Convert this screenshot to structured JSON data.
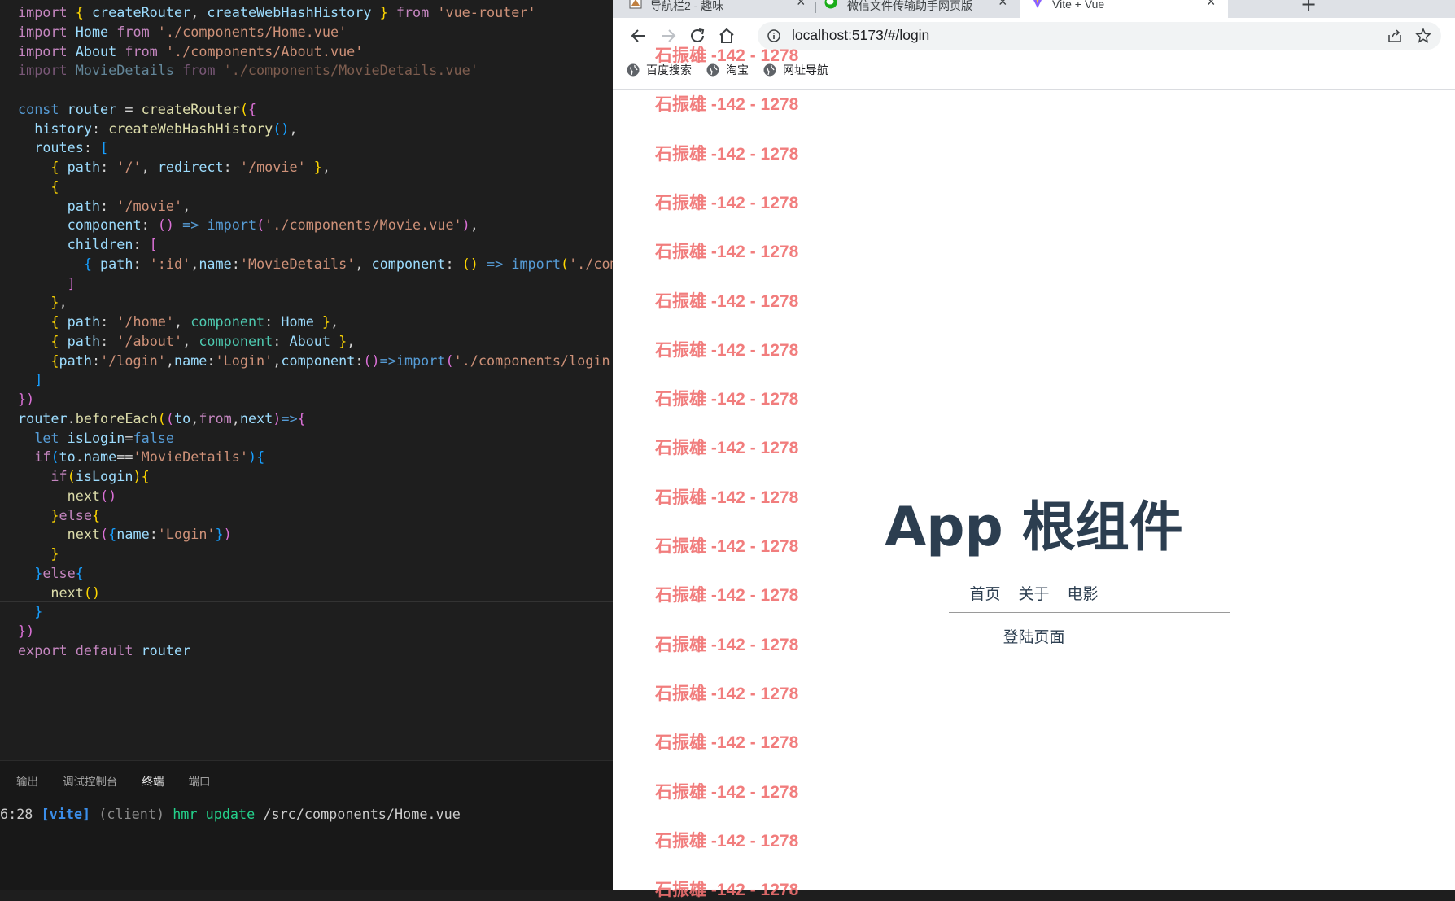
{
  "editor": {
    "lines": [
      [
        {
          "t": "import",
          "c": "kw"
        },
        {
          "t": " "
        },
        {
          "t": "{",
          "c": "b1"
        },
        {
          "t": " "
        },
        {
          "t": "createRouter",
          "c": "var"
        },
        {
          "t": ", "
        },
        {
          "t": "createWebHashHistory",
          "c": "var"
        },
        {
          "t": " "
        },
        {
          "t": "}",
          "c": "b1"
        },
        {
          "t": " "
        },
        {
          "t": "from",
          "c": "kw"
        },
        {
          "t": " "
        },
        {
          "t": "'vue-router'",
          "c": "str"
        }
      ],
      [
        {
          "t": "import",
          "c": "kw"
        },
        {
          "t": " "
        },
        {
          "t": "Home",
          "c": "var"
        },
        {
          "t": " "
        },
        {
          "t": "from",
          "c": "kw"
        },
        {
          "t": " "
        },
        {
          "t": "'./components/Home.vue'",
          "c": "str"
        }
      ],
      [
        {
          "t": "import",
          "c": "kw"
        },
        {
          "t": " "
        },
        {
          "t": "About",
          "c": "var"
        },
        {
          "t": " "
        },
        {
          "t": "from",
          "c": "kw"
        },
        {
          "t": " "
        },
        {
          "t": "'./components/About.vue'",
          "c": "str"
        }
      ],
      [
        {
          "t": "import",
          "c": "kw dim"
        },
        {
          "t": " "
        },
        {
          "t": "MovieDetails",
          "c": "var dim"
        },
        {
          "t": " "
        },
        {
          "t": "from",
          "c": "kw dim"
        },
        {
          "t": " "
        },
        {
          "t": "'./components/MovieDetails.vue'",
          "c": "str dim"
        }
      ],
      [],
      [
        {
          "t": "const",
          "c": "kb"
        },
        {
          "t": " "
        },
        {
          "t": "router",
          "c": "var"
        },
        {
          "t": " = "
        },
        {
          "t": "createRouter",
          "c": "fn"
        },
        {
          "t": "(",
          "c": "b1"
        },
        {
          "t": "{",
          "c": "b2"
        }
      ],
      [
        {
          "t": "  "
        },
        {
          "t": "history",
          "c": "var"
        },
        {
          "t": ": "
        },
        {
          "t": "createWebHashHistory",
          "c": "fn"
        },
        {
          "t": "()",
          "c": "b3"
        },
        {
          "t": ","
        }
      ],
      [
        {
          "t": "  "
        },
        {
          "t": "routes",
          "c": "var"
        },
        {
          "t": ": "
        },
        {
          "t": "[",
          "c": "b3"
        }
      ],
      [
        {
          "t": "    "
        },
        {
          "t": "{",
          "c": "b1"
        },
        {
          "t": " "
        },
        {
          "t": "path",
          "c": "var"
        },
        {
          "t": ": "
        },
        {
          "t": "'/'",
          "c": "str"
        },
        {
          "t": ", "
        },
        {
          "t": "redirect",
          "c": "var"
        },
        {
          "t": ": "
        },
        {
          "t": "'/movie'",
          "c": "str"
        },
        {
          "t": " "
        },
        {
          "t": "}",
          "c": "b1"
        },
        {
          "t": ","
        }
      ],
      [
        {
          "t": "    "
        },
        {
          "t": "{",
          "c": "b1"
        }
      ],
      [
        {
          "t": "      "
        },
        {
          "t": "path",
          "c": "var"
        },
        {
          "t": ": "
        },
        {
          "t": "'/movie'",
          "c": "str"
        },
        {
          "t": ","
        }
      ],
      [
        {
          "t": "      "
        },
        {
          "t": "component",
          "c": "var"
        },
        {
          "t": ": "
        },
        {
          "t": "()",
          "c": "b2"
        },
        {
          "t": " "
        },
        {
          "t": "=>",
          "c": "kb"
        },
        {
          "t": " "
        },
        {
          "t": "import",
          "c": "kb"
        },
        {
          "t": "(",
          "c": "b2"
        },
        {
          "t": "'./components/Movie.vue'",
          "c": "str"
        },
        {
          "t": ")",
          "c": "b2"
        },
        {
          "t": ","
        }
      ],
      [
        {
          "t": "      "
        },
        {
          "t": "children",
          "c": "var"
        },
        {
          "t": ": "
        },
        {
          "t": "[",
          "c": "b2"
        }
      ],
      [
        {
          "t": "        "
        },
        {
          "t": "{",
          "c": "b3"
        },
        {
          "t": " "
        },
        {
          "t": "path",
          "c": "var"
        },
        {
          "t": ": "
        },
        {
          "t": "':id'",
          "c": "str"
        },
        {
          "t": ","
        },
        {
          "t": "name",
          "c": "var"
        },
        {
          "t": ":"
        },
        {
          "t": "'MovieDetails'",
          "c": "str"
        },
        {
          "t": ", "
        },
        {
          "t": "component",
          "c": "var"
        },
        {
          "t": ": "
        },
        {
          "t": "()",
          "c": "b1"
        },
        {
          "t": " "
        },
        {
          "t": "=>",
          "c": "kb"
        },
        {
          "t": " "
        },
        {
          "t": "import",
          "c": "kb"
        },
        {
          "t": "(",
          "c": "b1"
        },
        {
          "t": "'./compon",
          "c": "str"
        }
      ],
      [
        {
          "t": "      "
        },
        {
          "t": "]",
          "c": "b2"
        }
      ],
      [
        {
          "t": "    "
        },
        {
          "t": "}",
          "c": "b1"
        },
        {
          "t": ","
        }
      ],
      [
        {
          "t": "    "
        },
        {
          "t": "{",
          "c": "b1"
        },
        {
          "t": " "
        },
        {
          "t": "path",
          "c": "var"
        },
        {
          "t": ": "
        },
        {
          "t": "'/home'",
          "c": "str"
        },
        {
          "t": ", "
        },
        {
          "t": "component",
          "c": "cls"
        },
        {
          "t": ": "
        },
        {
          "t": "Home",
          "c": "var"
        },
        {
          "t": " "
        },
        {
          "t": "}",
          "c": "b1"
        },
        {
          "t": ","
        }
      ],
      [
        {
          "t": "    "
        },
        {
          "t": "{",
          "c": "b1"
        },
        {
          "t": " "
        },
        {
          "t": "path",
          "c": "var"
        },
        {
          "t": ": "
        },
        {
          "t": "'/about'",
          "c": "str"
        },
        {
          "t": ", "
        },
        {
          "t": "component",
          "c": "cls"
        },
        {
          "t": ": "
        },
        {
          "t": "About",
          "c": "var"
        },
        {
          "t": " "
        },
        {
          "t": "}",
          "c": "b1"
        },
        {
          "t": ","
        }
      ],
      [
        {
          "t": "    "
        },
        {
          "t": "{",
          "c": "b1"
        },
        {
          "t": "path",
          "c": "var"
        },
        {
          "t": ":"
        },
        {
          "t": "'/login'",
          "c": "str"
        },
        {
          "t": ","
        },
        {
          "t": "name",
          "c": "var"
        },
        {
          "t": ":"
        },
        {
          "t": "'Login'",
          "c": "str"
        },
        {
          "t": ","
        },
        {
          "t": "component",
          "c": "var"
        },
        {
          "t": ":"
        },
        {
          "t": "()",
          "c": "b2"
        },
        {
          "t": "=>",
          "c": "kb"
        },
        {
          "t": "import",
          "c": "kb"
        },
        {
          "t": "(",
          "c": "b2"
        },
        {
          "t": "'./components/login.vue",
          "c": "str"
        }
      ],
      [
        {
          "t": "  "
        },
        {
          "t": "]",
          "c": "b3"
        }
      ],
      [
        {
          "t": "})",
          "c": "b2"
        }
      ],
      [
        {
          "t": "router",
          "c": "var"
        },
        {
          "t": "."
        },
        {
          "t": "beforeEach",
          "c": "fn"
        },
        {
          "t": "(",
          "c": "b1"
        },
        {
          "t": "(",
          "c": "b2"
        },
        {
          "t": "to",
          "c": "var"
        },
        {
          "t": ","
        },
        {
          "t": "from",
          "c": "kw"
        },
        {
          "t": ","
        },
        {
          "t": "next",
          "c": "var"
        },
        {
          "t": ")",
          "c": "b2"
        },
        {
          "t": "=>",
          "c": "kb"
        },
        {
          "t": "{",
          "c": "b2"
        }
      ],
      [
        {
          "t": "  "
        },
        {
          "t": "let",
          "c": "kb"
        },
        {
          "t": " "
        },
        {
          "t": "isLogin",
          "c": "var"
        },
        {
          "t": "="
        },
        {
          "t": "false",
          "c": "kb"
        }
      ],
      [
        {
          "t": "  "
        },
        {
          "t": "if",
          "c": "kw"
        },
        {
          "t": "(",
          "c": "b3"
        },
        {
          "t": "to",
          "c": "var"
        },
        {
          "t": "."
        },
        {
          "t": "name",
          "c": "var"
        },
        {
          "t": "=="
        },
        {
          "t": "'MovieDetails'",
          "c": "str"
        },
        {
          "t": ")",
          "c": "b3"
        },
        {
          "t": "{",
          "c": "b3"
        }
      ],
      [
        {
          "t": "    "
        },
        {
          "t": "if",
          "c": "kw"
        },
        {
          "t": "(",
          "c": "b1"
        },
        {
          "t": "isLogin",
          "c": "var"
        },
        {
          "t": ")",
          "c": "b1"
        },
        {
          "t": "{",
          "c": "b1"
        }
      ],
      [
        {
          "t": "      "
        },
        {
          "t": "next",
          "c": "fn"
        },
        {
          "t": "()",
          "c": "b2"
        }
      ],
      [
        {
          "t": "    "
        },
        {
          "t": "}",
          "c": "b1"
        },
        {
          "t": "else",
          "c": "kw"
        },
        {
          "t": "{",
          "c": "b1"
        }
      ],
      [
        {
          "t": "      "
        },
        {
          "t": "next",
          "c": "fn"
        },
        {
          "t": "(",
          "c": "b2"
        },
        {
          "t": "{",
          "c": "b3"
        },
        {
          "t": "name",
          "c": "var"
        },
        {
          "t": ":"
        },
        {
          "t": "'Login'",
          "c": "str"
        },
        {
          "t": "}",
          "c": "b3"
        },
        {
          "t": ")",
          "c": "b2"
        }
      ],
      [
        {
          "t": "    "
        },
        {
          "t": "}",
          "c": "b1"
        }
      ],
      [
        {
          "t": "  "
        },
        {
          "t": "}",
          "c": "b3"
        },
        {
          "t": "else",
          "c": "kw"
        },
        {
          "t": "{",
          "c": "b3"
        }
      ],
      [
        {
          "t": "    "
        },
        {
          "t": "next",
          "c": "fn"
        },
        {
          "t": "()",
          "c": "b1"
        }
      ],
      [
        {
          "t": "  "
        },
        {
          "t": "}",
          "c": "b3"
        }
      ],
      [
        {
          "t": "})",
          "c": "b2"
        }
      ],
      [
        {
          "t": "export",
          "c": "kw"
        },
        {
          "t": " "
        },
        {
          "t": "default",
          "c": "kw"
        },
        {
          "t": " "
        },
        {
          "t": "router",
          "c": "var"
        }
      ]
    ],
    "cursor_line": 30
  },
  "panel": {
    "tabs": [
      "输出",
      "调试控制台",
      "终端",
      "端口"
    ],
    "active_tab": "终端",
    "terminal": {
      "time": "6:28",
      "tag": "[vite]",
      "client": "(client)",
      "hmr": "hmr update",
      "path": "/src/components/Home.vue"
    }
  },
  "browser": {
    "tabs": [
      {
        "label": "导航栏2 - 趣味",
        "active": false
      },
      {
        "label": "微信文件传输助手网页版",
        "active": false
      },
      {
        "label": "Vite + Vue",
        "active": true
      }
    ],
    "address": "localhost:5173/#/login",
    "bookmarks": [
      "百度搜索",
      "淘宝",
      "网址导航"
    ],
    "page": {
      "title": "App 根组件",
      "nav": [
        "首页",
        "关于",
        "电影"
      ],
      "content": "登陆页面"
    }
  },
  "watermark": {
    "text": "石振雄 -142 - 1278",
    "count": 18,
    "color": "#f07070"
  },
  "colors": {
    "editor_bg": "#1e1e1e",
    "panel_bg": "#181818",
    "heading": "#2c3e50",
    "tabstrip": "#dee1e6"
  }
}
